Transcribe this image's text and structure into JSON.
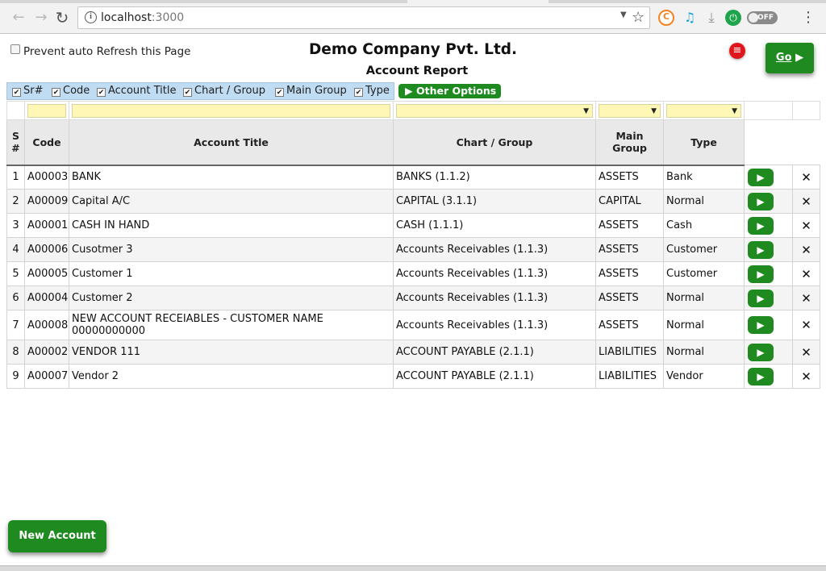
{
  "browser": {
    "url_host": "localhost",
    "url_port": ":3000",
    "ext_off_label": "OFF",
    "icons": [
      "back-icon",
      "forward-icon",
      "reload-icon",
      "info-icon",
      "star-icon",
      "menu-icon"
    ]
  },
  "header": {
    "prevent_refresh_label": "Prevent auto Refresh this Page",
    "company": "Demo Company Pvt. Ltd.",
    "report": "Account Report",
    "go_label": "Go",
    "go_arrow": "▶"
  },
  "columns_toggle": [
    {
      "label": "Sr#",
      "checked": true
    },
    {
      "label": "Code",
      "checked": true
    },
    {
      "label": "Account Title",
      "checked": true
    },
    {
      "label": "Chart / Group",
      "checked": true
    },
    {
      "label": "Main Group",
      "checked": true
    },
    {
      "label": "Type",
      "checked": true
    }
  ],
  "other_options_label": "▶ Other Options",
  "table": {
    "headers": {
      "sr": "S #",
      "code": "Code",
      "title": "Account Title",
      "chart": "Chart / Group",
      "main": "Main Group",
      "type": "Type"
    },
    "rows": [
      {
        "sr": "1",
        "code": "A00003",
        "title": "BANK",
        "chart": "BANKS (1.1.2)",
        "main": "ASSETS",
        "type": "Bank"
      },
      {
        "sr": "2",
        "code": "A00009",
        "title": "Capital A/C",
        "chart": "CAPITAL (3.1.1)",
        "main": "CAPITAL",
        "type": "Normal"
      },
      {
        "sr": "3",
        "code": "A00001",
        "title": "CASH IN HAND",
        "chart": "CASH (1.1.1)",
        "main": "ASSETS",
        "type": "Cash"
      },
      {
        "sr": "4",
        "code": "A00006",
        "title": "Cusotmer 3",
        "chart": "Accounts Receivables (1.1.3)",
        "main": "ASSETS",
        "type": "Customer"
      },
      {
        "sr": "5",
        "code": "A00005",
        "title": "Customer 1",
        "chart": "Accounts Receivables (1.1.3)",
        "main": "ASSETS",
        "type": "Customer"
      },
      {
        "sr": "6",
        "code": "A00004",
        "title": "Customer 2",
        "chart": "Accounts Receivables (1.1.3)",
        "main": "ASSETS",
        "type": "Normal"
      },
      {
        "sr": "7",
        "code": "A00008",
        "title": "NEW ACCOUNT RECEIABLES - CUSTOMER NAME 00000000000",
        "chart": "Accounts Receivables (1.1.3)",
        "main": "ASSETS",
        "type": "Normal"
      },
      {
        "sr": "8",
        "code": "A00002",
        "title": "VENDOR 111",
        "chart": "ACCOUNT PAYABLE (2.1.1)",
        "main": "LIABILITIES",
        "type": "Normal"
      },
      {
        "sr": "9",
        "code": "A00007",
        "title": "Vendor 2",
        "chart": "ACCOUNT PAYABLE (2.1.1)",
        "main": "LIABILITIES",
        "type": "Vendor"
      }
    ],
    "row_action_icon": "▶",
    "delete_icon": "✕"
  },
  "new_account_label": "New Account",
  "colors": {
    "green": "#1f8a1f",
    "filter_yellow": "#fff7b6",
    "toggle_bar": "#bfdcf3",
    "delete_red": "#d22"
  }
}
